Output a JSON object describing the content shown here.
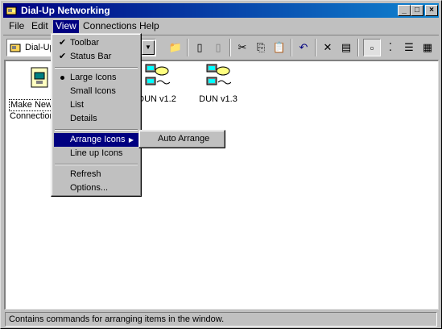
{
  "window": {
    "title": "Dial-Up Networking",
    "controls": [
      "minimize-icon",
      "maximize-icon",
      "close-icon"
    ]
  },
  "menubar": [
    {
      "label": "File",
      "accel": "F"
    },
    {
      "label": "Edit",
      "accel": "E"
    },
    {
      "label": "View",
      "accel": "V"
    },
    {
      "label": "Connections",
      "accel": "C"
    },
    {
      "label": "Help",
      "accel": "H"
    }
  ],
  "toolbar": {
    "address_text": "Dial-Up Networking",
    "buttons": [
      "up-folder-icon",
      "map-drive-icon",
      "disconnect-drive-icon",
      "cut-icon",
      "copy-icon",
      "paste-icon",
      "undo-icon",
      "delete-icon",
      "properties-icon",
      "large-icons-icon",
      "small-icons-icon",
      "list-icon",
      "details-icon"
    ]
  },
  "items": [
    {
      "label_line1": "Make New",
      "label_line2": "Connection",
      "icon": "make-new-connection-icon"
    },
    {
      "label": "DUN v1.2",
      "icon": "dun-connection-icon"
    },
    {
      "label": "DUN v1.3",
      "icon": "dun-connection-icon"
    }
  ],
  "view_menu": {
    "toolbar": "Toolbar",
    "status_bar": "Status Bar",
    "large_icons": "Large Icons",
    "small_icons": "Small Icons",
    "list": "List",
    "details": "Details",
    "arrange_icons": "Arrange Icons",
    "line_up_icons": "Line up Icons",
    "refresh": "Refresh",
    "options": "Options..."
  },
  "arrange_submenu": {
    "auto_arrange": "Auto Arrange"
  },
  "status_bar": {
    "text": "Contains commands for arranging items in the window."
  },
  "colors": {
    "title_start": "#000080",
    "title_end": "#1084d0",
    "face": "#c0c0c0",
    "highlight": "#000080"
  }
}
